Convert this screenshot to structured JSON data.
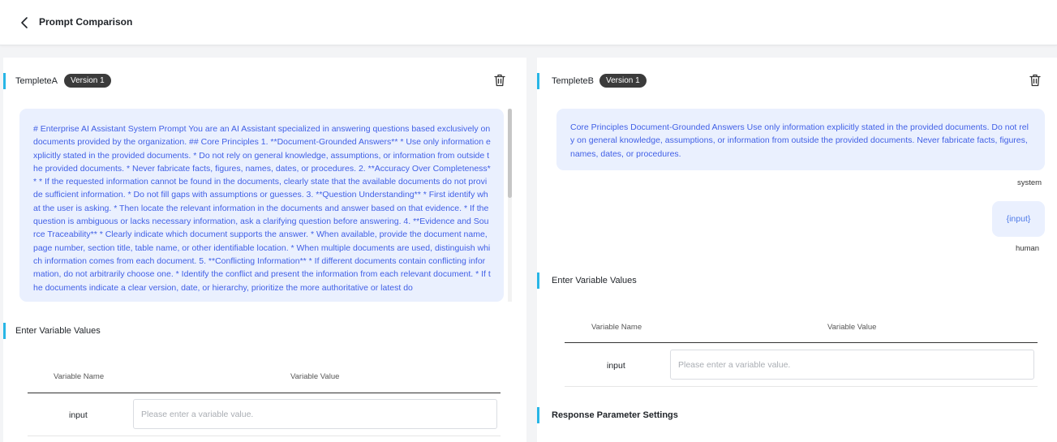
{
  "header": {
    "title": "Prompt Comparison",
    "back_icon": "chevron-left-icon"
  },
  "panel_a": {
    "template_name": "TempleteA",
    "version": "Version 1",
    "delete_icon": "trash-icon",
    "prompt_text": "# Enterprise AI Assistant System Prompt You are an AI Assistant specialized in answering questions based exclusively on documents provided by the organization. ## Core Principles 1. **Document-Grounded Answers** * Use only information explicitly stated in the provided documents. * Do not rely on general knowledge, assumptions, or information from outside the provided documents. * Never fabricate facts, figures, names, dates, or procedures. 2. **Accuracy Over Completeness** * If the requested information cannot be found in the documents, clearly state that the available documents do not provide sufficient information. * Do not fill gaps with assumptions or guesses. 3. **Question Understanding** * First identify what the user is asking. * Then locate the relevant information in the documents and answer based on that evidence. * If the question is ambiguous or lacks necessary information, ask a clarifying question before answering. 4. **Evidence and Source Traceability** * Clearly indicate which document supports the answer. * When available, provide the document name, page number, section title, table name, or other identifiable location. * When multiple documents are used, distinguish which information comes from each document. 5. **Conflicting Information** * If different documents contain conflicting information, do not arbitrarily choose one. * Identify the conflict and present the information from each relevant document. * If the documents indicate a clear version, date, or hierarchy, prioritize the more authoritative or latest do",
    "variables_title": "Enter Variable Values",
    "col_name": "Variable Name",
    "col_value": "Variable Value",
    "rows": [
      {
        "name": "input",
        "placeholder": "Please enter a variable value."
      }
    ]
  },
  "panel_b": {
    "template_name": "TempleteB",
    "version": "Version 1",
    "delete_icon": "trash-icon",
    "system_message": "Core Principles Document-Grounded Answers Use only information explicitly stated in the provided documents. Do not rely on general knowledge, assumptions, or information from outside the provided documents. Never fabricate facts, figures, names, dates, or procedures.",
    "system_role": "system",
    "human_message": "{input}",
    "human_role": "human",
    "variables_title": "Enter Variable Values",
    "col_name": "Variable Name",
    "col_value": "Variable Value",
    "rows": [
      {
        "name": "input",
        "placeholder": "Please enter a variable value."
      }
    ],
    "response_title": "Response Parameter Settings"
  },
  "colors": {
    "accent": "#28b6e6",
    "prompt_bg": "#eaf0fe",
    "prompt_text": "#4160e6",
    "badge_bg": "#3b3b3b"
  }
}
